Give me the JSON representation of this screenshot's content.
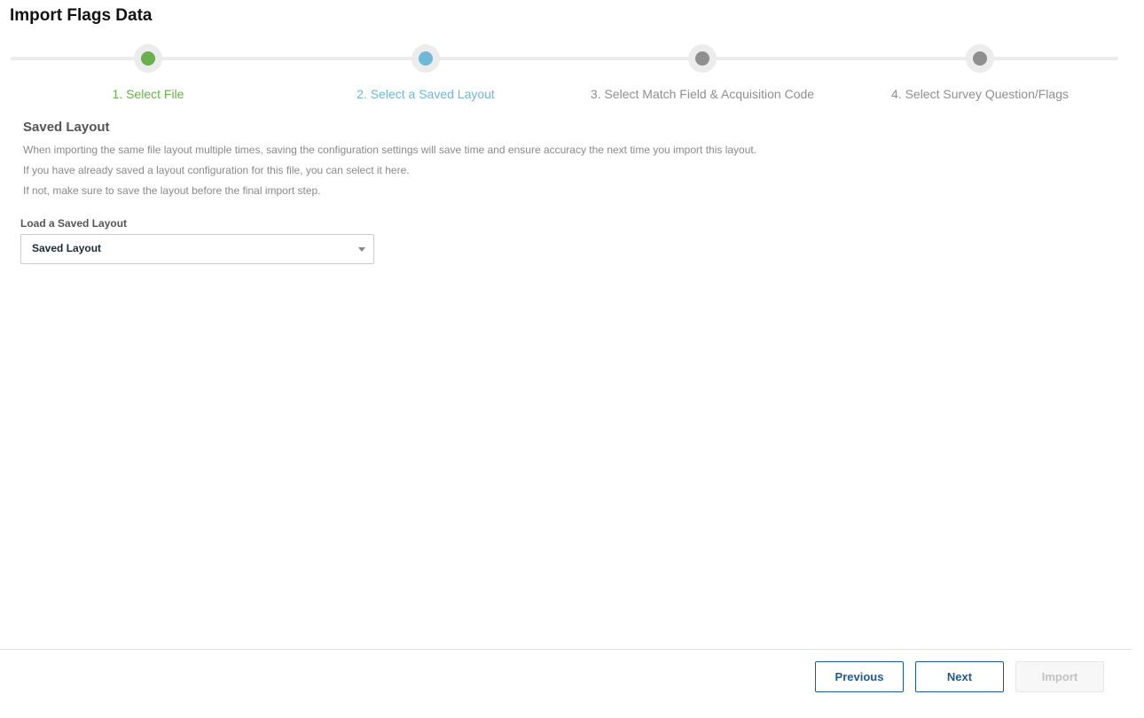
{
  "page": {
    "title": "Import Flags Data"
  },
  "stepper": {
    "steps": [
      {
        "label": "1. Select File",
        "state": "complete",
        "color": "#6ab04c"
      },
      {
        "label": "2. Select a Saved Layout",
        "state": "active",
        "color": "#6fb8d6"
      },
      {
        "label": "3. Select Match Field & Acquisition Code",
        "state": "pending",
        "color": "#8f8f8f"
      },
      {
        "label": "4. Select Survey Question/Flags",
        "state": "pending",
        "color": "#8f8f8f"
      }
    ]
  },
  "saved_layout": {
    "title": "Saved Layout",
    "descriptions": [
      "When importing the same file layout multiple times, saving the configuration settings will save time and ensure accuracy the next time you import this layout.",
      "If you have already saved a layout configuration for this file, you can select it here.",
      "If not, make sure to save the layout before the final import step."
    ],
    "field_label": "Load a Saved Layout",
    "select_value": "Saved Layout",
    "select_icon": "chevron-down-icon"
  },
  "footer": {
    "previous_label": "Previous",
    "next_label": "Next",
    "import_label": "Import",
    "import_disabled": true
  },
  "colors": {
    "accent": "#1d5a96",
    "complete": "#6ab04c",
    "active": "#6fb8d6",
    "pending": "#8f8f8f"
  }
}
